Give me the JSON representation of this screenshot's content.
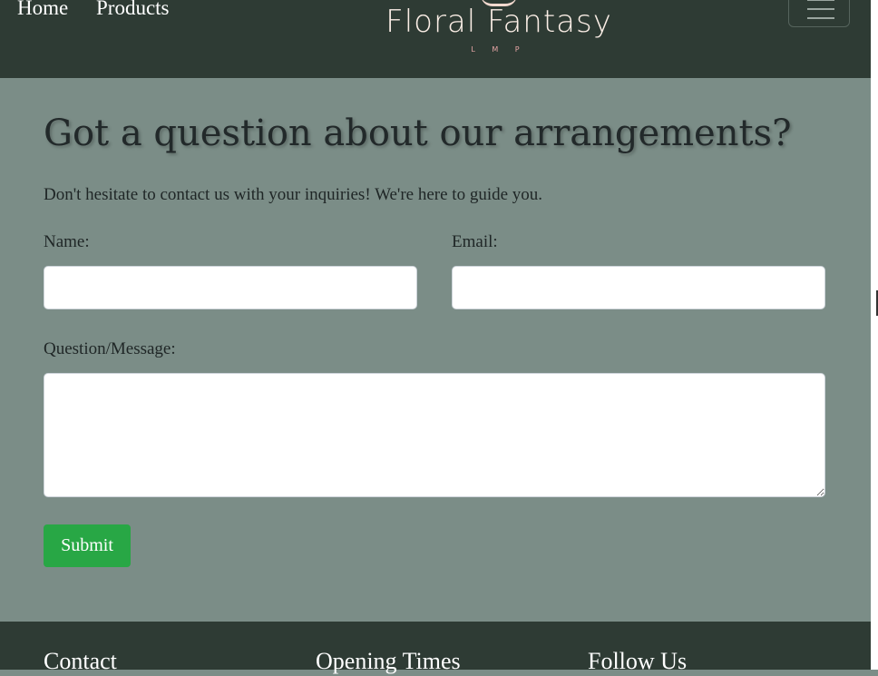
{
  "header": {
    "nav": [
      {
        "label": "Home"
      },
      {
        "label": "Products"
      }
    ],
    "logo": {
      "title": "Floral Fantasy",
      "subtitle": "L M P"
    },
    "menu_toggle_icon": "hamburger-icon"
  },
  "main": {
    "title": "Got a question about our arrangements?",
    "lead": "Don't hesitate to contact us with your inquiries! We're here to guide you.",
    "form": {
      "name_label": "Name:",
      "name_value": "",
      "email_label": "Email:",
      "email_value": "",
      "message_label": "Question/Message:",
      "message_value": "",
      "submit_label": "Submit"
    }
  },
  "footer": {
    "headings": [
      "Contact",
      "Opening Times",
      "Follow Us"
    ]
  },
  "colors": {
    "header_bg": "#2e3b34",
    "main_bg": "#7b8d87",
    "submit_bg": "#28a745"
  }
}
